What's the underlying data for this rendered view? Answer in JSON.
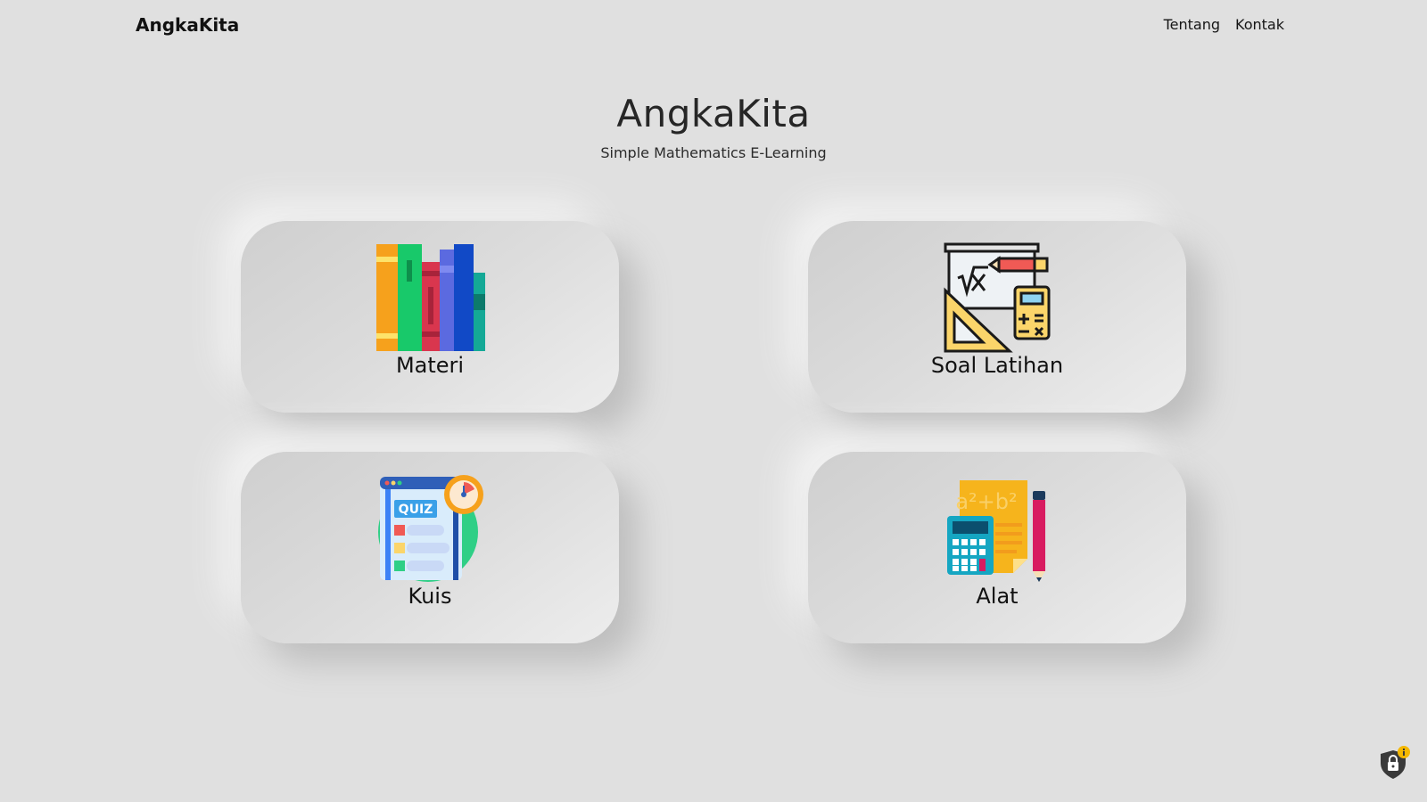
{
  "navbar": {
    "brand": "AngkaKita",
    "links": [
      {
        "label": "Tentang"
      },
      {
        "label": "Kontak"
      }
    ]
  },
  "hero": {
    "title": "AngkaKita",
    "subtitle": "Simple Mathematics E-Learning"
  },
  "cards": [
    {
      "label": "Materi",
      "icon": "books-icon"
    },
    {
      "label": "Soal Latihan",
      "icon": "math-board-calculator-icon"
    },
    {
      "label": "Kuis",
      "icon": "quiz-icon"
    },
    {
      "label": "Alat",
      "icon": "calculator-pencil-icon"
    }
  ],
  "quiz_icon_text": "QUIZ",
  "colors": {
    "background": "#e0e0e0",
    "text": "#1d1d1d",
    "badge": "#f5b800"
  },
  "overlay": {
    "icon": "lock-info-icon"
  }
}
